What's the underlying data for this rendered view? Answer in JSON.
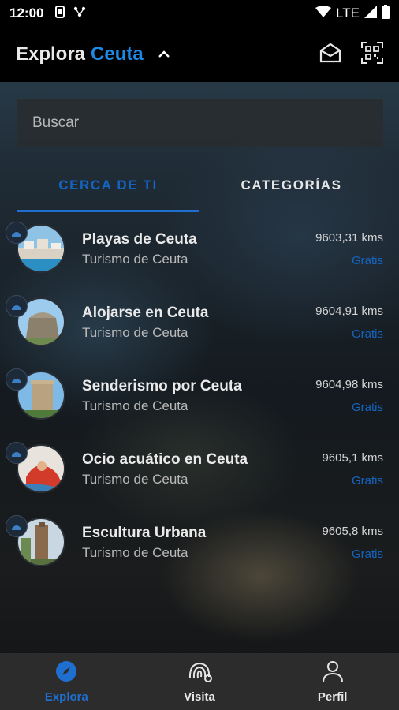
{
  "status_bar": {
    "time": "12:00",
    "network": "LTE"
  },
  "app_bar": {
    "title_prefix": "Explora",
    "city": "Ceuta"
  },
  "search": {
    "placeholder": "Buscar"
  },
  "tabs": [
    {
      "label": "CERCA DE TI",
      "active": true
    },
    {
      "label": "CATEGORÍAS",
      "active": false
    }
  ],
  "colors": {
    "accent": "#1e6fd0",
    "bottom_nav_bg": "#2c2c2c",
    "app_bar_bg": "#000000"
  },
  "items": [
    {
      "name": "Playas de Ceuta",
      "subtitle": "Turismo de Ceuta",
      "distance": "9603,31 kms",
      "price": "Gratis"
    },
    {
      "name": "Alojarse en Ceuta",
      "subtitle": "Turismo de Ceuta",
      "distance": "9604,91 kms",
      "price": "Gratis"
    },
    {
      "name": "Senderismo por Ceuta",
      "subtitle": "Turismo de Ceuta",
      "distance": "9604,98 kms",
      "price": "Gratis"
    },
    {
      "name": "Ocio acuático en Ceuta",
      "subtitle": "Turismo de Ceuta",
      "distance": "9605,1 kms",
      "price": "Gratis"
    },
    {
      "name": "Escultura Urbana",
      "subtitle": "Turismo de Ceuta",
      "distance": "9605,8 kms",
      "price": "Gratis"
    }
  ],
  "bottom_nav": [
    {
      "label": "Explora",
      "icon": "compass-icon",
      "active": true
    },
    {
      "label": "Visita",
      "icon": "fingerprint-icon",
      "active": false
    },
    {
      "label": "Perfil",
      "icon": "person-icon",
      "active": false
    }
  ]
}
